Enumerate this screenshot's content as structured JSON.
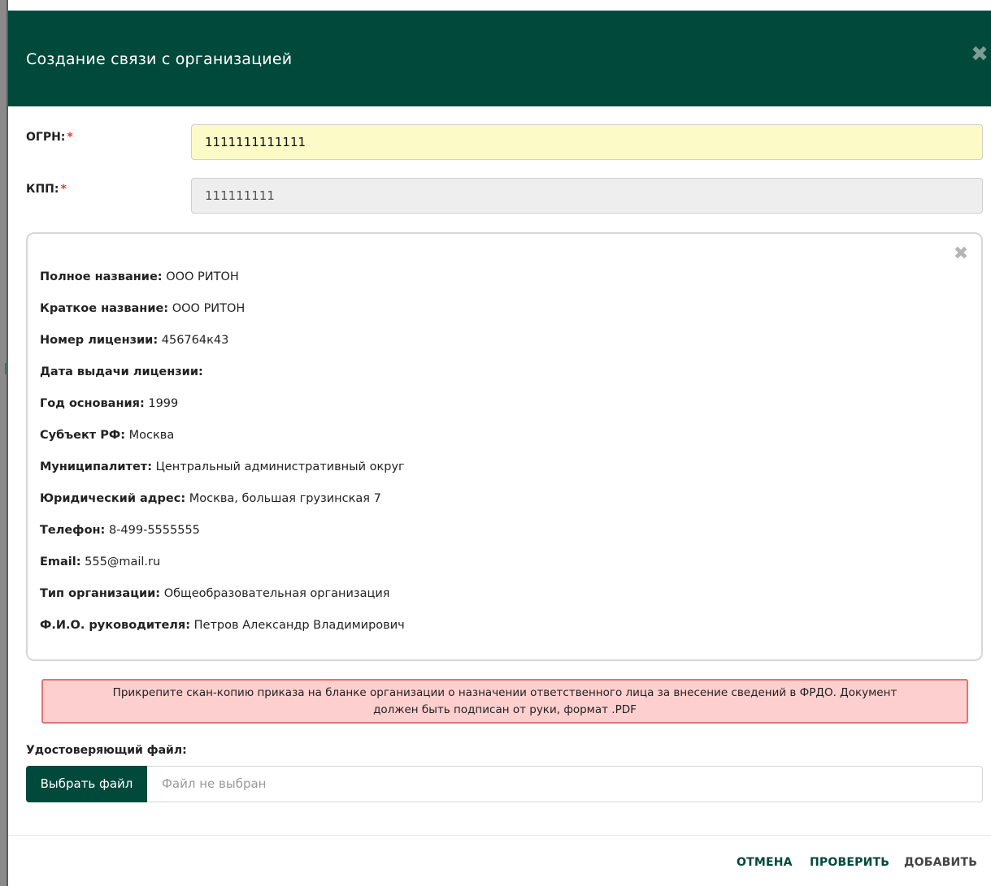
{
  "dialog": {
    "title": "Создание связи с организацией",
    "close_icon": "close-icon"
  },
  "form": {
    "ogrn": {
      "label": "ОГРН:",
      "required_mark": "*",
      "value": "1111111111111"
    },
    "kpp": {
      "label": "КПП:",
      "required_mark": "*",
      "value": "111111111"
    }
  },
  "org_info": {
    "close_icon": "close-icon",
    "rows": [
      {
        "label": "Полное название:",
        "value": "ООО РИТОН"
      },
      {
        "label": "Краткое название:",
        "value": "ООО РИТОН"
      },
      {
        "label": "Номер лицензии:",
        "value": "456764к43"
      },
      {
        "label": "Дата выдачи лицензии:",
        "value": ""
      },
      {
        "label": "Год основания:",
        "value": "1999"
      },
      {
        "label": "Субъект РФ:",
        "value": "Москва"
      },
      {
        "label": "Муниципалитет:",
        "value": "Центральный административный округ"
      },
      {
        "label": "Юридический адрес:",
        "value": "Москва, большая грузинская 7"
      },
      {
        "label": "Телефон:",
        "value": "8-499-5555555"
      },
      {
        "label": "Email:",
        "value": "555@mail.ru"
      },
      {
        "label": "Тип организации:",
        "value": "Общеобразовательная организация"
      },
      {
        "label": "Ф.И.О. руководителя:",
        "value": "Петров Александр Владимирович"
      }
    ]
  },
  "alert": {
    "line1": "Прикрепите скан-копию приказа на бланке организации о назначении ответственного лица за внесение сведений в ФРДО. Документ",
    "line2": "должен быть подписан от руки, формат .PDF"
  },
  "file": {
    "label": "Удостоверяющий файл:",
    "button_label": "Выбрать файл",
    "placeholder": "Файл не выбран"
  },
  "footer": {
    "cancel": "ОТМЕНА",
    "check": "ПРОВЕРИТЬ",
    "add": "ДОБАВИТЬ"
  },
  "colors": {
    "header": "#00493b",
    "ogrn_field_bg": "#fcfbc7",
    "kpp_field_bg": "#eeeeee",
    "alert_bg": "#fecfcf",
    "alert_border": "#e57373",
    "required": "#e53935"
  }
}
